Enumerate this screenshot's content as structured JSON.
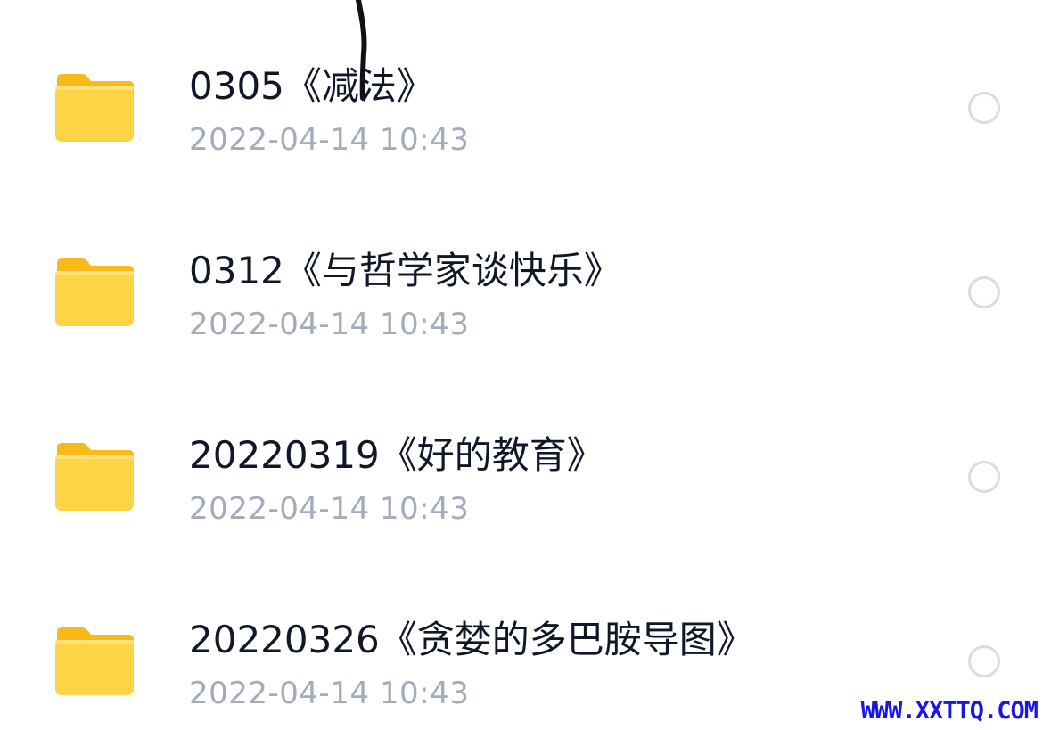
{
  "files": [
    {
      "name": "0305《减法》",
      "date": "2022-04-14 10:43",
      "icon": "folder-icon"
    },
    {
      "name": "0312《与哲学家谈快乐》",
      "date": "2022-04-14 10:43",
      "icon": "folder-icon"
    },
    {
      "name": "20220319《好的教育》",
      "date": "2022-04-14 10:43",
      "icon": "folder-icon"
    },
    {
      "name": "20220326《贪婪的多巴胺导图》",
      "date": "2022-04-14 10:43",
      "icon": "folder-icon"
    }
  ],
  "watermark": "WWW.XXTTQ.COM",
  "colors": {
    "folder_back": "#f8b91a",
    "folder_front": "#fdd446",
    "name_text": "#101828",
    "date_text": "#a4acbb",
    "radio_border": "#d9dce2",
    "watermark": "#1a16e6"
  }
}
